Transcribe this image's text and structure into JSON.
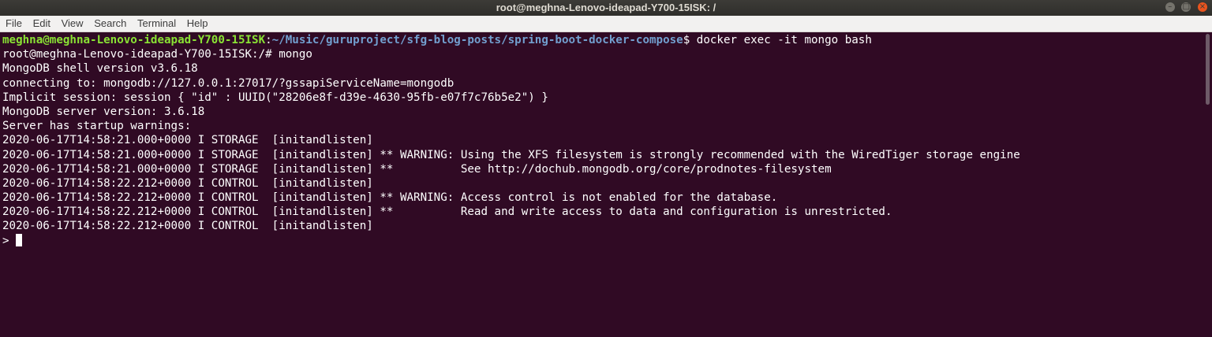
{
  "window": {
    "title": "root@meghna-Lenovo-ideapad-Y700-15ISK: /",
    "controls": [
      "minimize-icon",
      "maximize-icon",
      "close-icon"
    ]
  },
  "menu": {
    "items": [
      "File",
      "Edit",
      "View",
      "Search",
      "Terminal",
      "Help"
    ]
  },
  "terminal": {
    "prompt_user": "meghna@meghna-Lenovo-ideapad-Y700-15ISK",
    "prompt_sep": ":",
    "prompt_path": "~/Music/guruproject/sfg-blog-posts/spring-boot-docker-compose",
    "prompt_command": "$ docker exec -it mongo bash",
    "lines": [
      "root@meghna-Lenovo-ideapad-Y700-15ISK:/# mongo",
      "MongoDB shell version v3.6.18",
      "connecting to: mongodb://127.0.0.1:27017/?gssapiServiceName=mongodb",
      "Implicit session: session { \"id\" : UUID(\"28206e8f-d39e-4630-95fb-e07f7c76b5e2\") }",
      "MongoDB server version: 3.6.18",
      "Server has startup warnings:",
      "2020-06-17T14:58:21.000+0000 I STORAGE  [initandlisten]",
      "2020-06-17T14:58:21.000+0000 I STORAGE  [initandlisten] ** WARNING: Using the XFS filesystem is strongly recommended with the WiredTiger storage engine",
      "2020-06-17T14:58:21.000+0000 I STORAGE  [initandlisten] **          See http://dochub.mongodb.org/core/prodnotes-filesystem",
      "2020-06-17T14:58:22.212+0000 I CONTROL  [initandlisten]",
      "2020-06-17T14:58:22.212+0000 I CONTROL  [initandlisten] ** WARNING: Access control is not enabled for the database.",
      "2020-06-17T14:58:22.212+0000 I CONTROL  [initandlisten] **          Read and write access to data and configuration is unrestricted.",
      "2020-06-17T14:58:22.212+0000 I CONTROL  [initandlisten]"
    ],
    "current_prompt": ">"
  },
  "colors": {
    "background": "#300a24",
    "prompt_user": "#8ae234",
    "prompt_path": "#729fcf",
    "text": "#ffffff"
  }
}
